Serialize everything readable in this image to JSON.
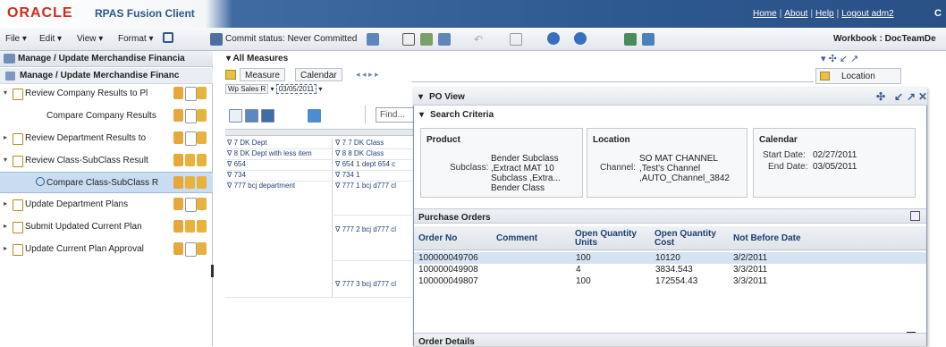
{
  "header": {
    "brand": "ORACLE",
    "product": "RPAS Fusion Client",
    "links": [
      "Home",
      "About",
      "Help",
      "Logout adm2"
    ],
    "cutoff": "C"
  },
  "toolbar": {
    "menus": [
      "File",
      "Edit",
      "View",
      "Format"
    ],
    "commit_status": "Commit status: Never Committed",
    "workbook": "Workbook : DocTeamDe"
  },
  "left_panel": {
    "title": "Manage / Update Merchandise Financia",
    "subtitle": "Manage / Update Merchandise Financ",
    "tasks": [
      {
        "label": "Review Company Results to Pl",
        "expanded": true
      },
      {
        "label": "Compare Company Results",
        "child": true
      },
      {
        "label": "Review Department Results to",
        "expanded": false
      },
      {
        "label": "Review Class-SubClass Result",
        "expanded": true
      },
      {
        "label": "Compare Class-SubClass R",
        "child": true,
        "selected": true
      },
      {
        "label": "Update Department Plans",
        "expanded": false
      },
      {
        "label": "Submit Updated Current Plan",
        "expanded": false
      },
      {
        "label": "Update Current Plan Approval",
        "expanded": false
      }
    ]
  },
  "middle": {
    "title": "All Measures",
    "tabs": [
      "Measure",
      "Calendar"
    ],
    "page_selector": [
      "Wp Sales R",
      "03/05/2011"
    ],
    "find_placeholder": "Find...",
    "grid": [
      {
        "col1": "7 DK Dept",
        "col2": "7 7 DK Class"
      },
      {
        "col1": "8 DK Dept with less item",
        "col2": "8 8 DK Class"
      },
      {
        "col1": "654",
        "col2": "654 1 dept 654 c"
      },
      {
        "col1": "734",
        "col2": "734 1"
      },
      {
        "col1": "777 bcj department",
        "col2": "777 1 bcj d777 cl"
      },
      {
        "col1": "",
        "col2": "777 2 bcj d777 cl"
      },
      {
        "col1": "",
        "col2": "777 3 bcj d777 cl"
      }
    ],
    "location_tab": "Location"
  },
  "po_view": {
    "title": "PO View",
    "search_title": "Search Criteria",
    "product": {
      "heading": "Product",
      "key": "Subclass:",
      "values": [
        "Bender Subclass",
        ",Extract MAT 10",
        "Subclass ,Extra...",
        "Bender Class"
      ]
    },
    "location": {
      "heading": "Location",
      "key": "Channel:",
      "values": [
        "SO MAT CHANNEL",
        ",Test's Channel",
        ",AUTO_Channel_3842"
      ]
    },
    "calendar": {
      "heading": "Calendar",
      "start_key": "Start Date:",
      "start_val": "02/27/2011",
      "end_key": "End Date:",
      "end_val": "03/05/2011"
    },
    "orders_title": "Purchase Orders",
    "columns": [
      "Order No",
      "Comment",
      "Open Quantity Units",
      "Open Quantity Cost",
      "Not Before Date"
    ],
    "rows": [
      {
        "order": "100000049706",
        "comment": "",
        "units": "100",
        "cost": "10120",
        "date": "3/2/2011",
        "selected": true
      },
      {
        "order": "100000049908",
        "comment": "",
        "units": "4",
        "cost": "3834.543",
        "date": "3/3/2011"
      },
      {
        "order": "100000049807",
        "comment": "",
        "units": "100",
        "cost": "172554.43",
        "date": "3/3/2011"
      }
    ],
    "details_title": "Order Details"
  },
  "colors": {
    "header_blue": "#2d5890",
    "oracle_red": "#d12b1d",
    "selected_row": "#d6e3f3"
  }
}
